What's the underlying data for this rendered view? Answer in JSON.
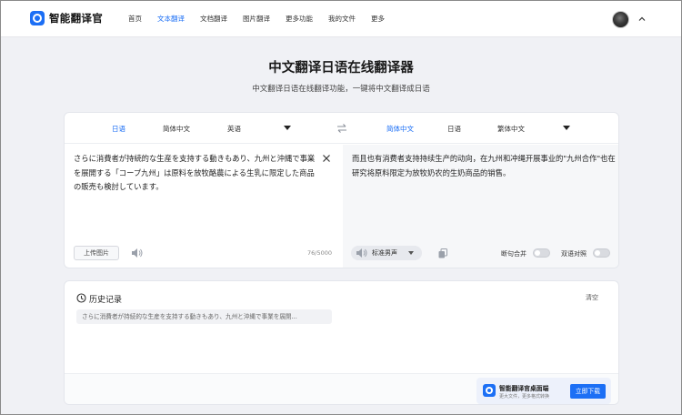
{
  "app": {
    "name": "智能翻译官"
  },
  "nav": {
    "items": [
      {
        "label": "首页"
      },
      {
        "label": "文本翻译",
        "active": true
      },
      {
        "label": "文档翻译"
      },
      {
        "label": "图片翻译"
      },
      {
        "label": "更多功能"
      },
      {
        "label": "我的文件"
      },
      {
        "label": "更多"
      }
    ]
  },
  "hero": {
    "title": "中文翻译日语在线翻译器",
    "subtitle": "中文翻译日语在线翻译功能，一键将中文翻译成日语"
  },
  "source": {
    "langs": [
      "日语",
      "简体中文",
      "英语"
    ],
    "text": "さらに消費者が持続的な生産を支持する動きもあり、九州と沖縄で事業を展開する「コープ九州」は原料を放牧酪農による生乳に限定した商品の販売も検討しています。",
    "upload_label": "上传图片",
    "char_count": "76/5000"
  },
  "target": {
    "langs": [
      "简体中文",
      "日语",
      "繁体中文"
    ],
    "text": "而且也有消费者支持持续生产的动向，在九州和冲绳开展事业的\"九州合作\"也在研究将原料限定为放牧奶农的生奶商品的销售。",
    "voice_label": "标准男声",
    "toggle_sentence": "断句合并",
    "toggle_compare": "双语对照"
  },
  "history": {
    "title": "历史记录",
    "clear_label": "清空",
    "items": [
      "さらに消費者が持続的な生産を支持する動きもあり、九州と沖縄で事業を展開..."
    ]
  },
  "promo": {
    "title": "智能翻译官桌面端",
    "subtitle": "更大文件，更多格式转换",
    "button": "立即下载"
  },
  "colors": {
    "accent": "#1c6ff5",
    "page_bg": "#f0f1f5"
  }
}
